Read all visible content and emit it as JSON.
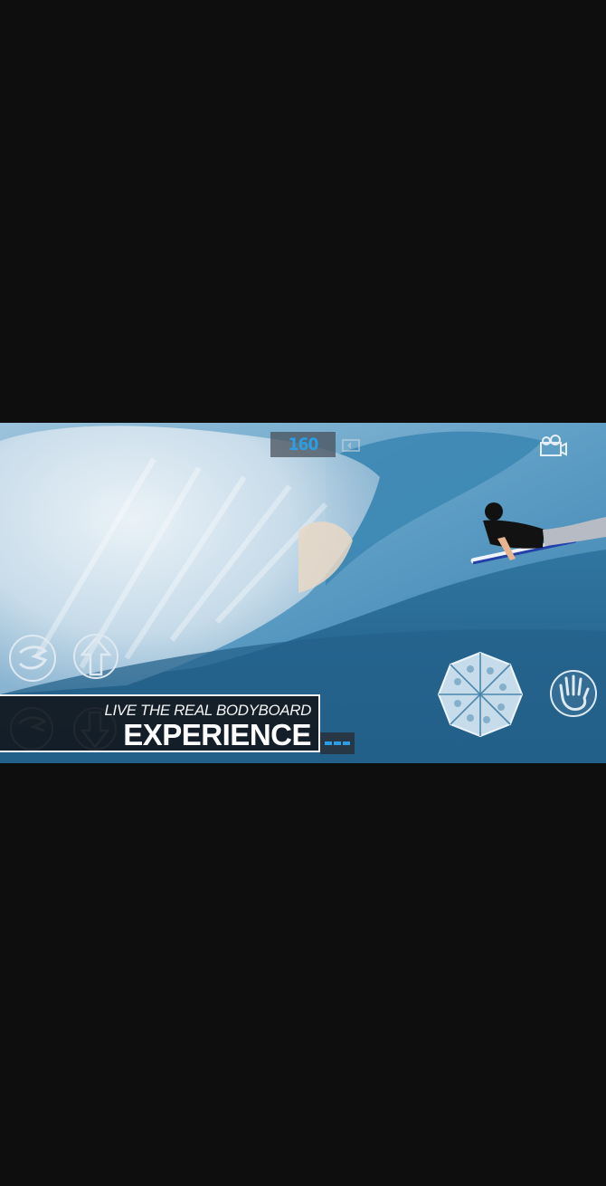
{
  "hud": {
    "score": "160",
    "retry_icon": "retry-icon",
    "camera_icon": "camera-icon"
  },
  "controls": {
    "trick_icon": "trick-swirl-icon",
    "up_icon": "arrow-up-icon",
    "down_icon": "arrow-down-icon",
    "spin_icon": "spin-wheel-icon",
    "grab_icon": "hand-grab-icon"
  },
  "promo": {
    "tagline": "LIVE THE REAL BODYBOARD",
    "headline": "EXPERIENCE"
  },
  "colors": {
    "background": "#0e0e0f",
    "ocean": "#2f7aa6",
    "accent": "#2b9fe6",
    "banner_bg": "#121418"
  }
}
